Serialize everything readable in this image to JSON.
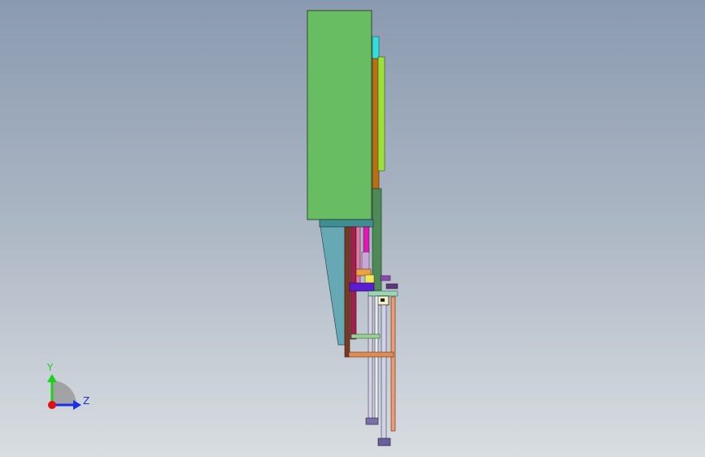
{
  "viewport": {
    "background_top": "#8a9ab0",
    "background_bottom": "#d8dde1"
  },
  "triad": {
    "y_label": "Y",
    "z_label": "Z",
    "y_color": "#1fcf1f",
    "z_color": "#1a2fe6",
    "x_color": "#e01010"
  },
  "model": {
    "icon": "cad-assembly-side-view"
  }
}
